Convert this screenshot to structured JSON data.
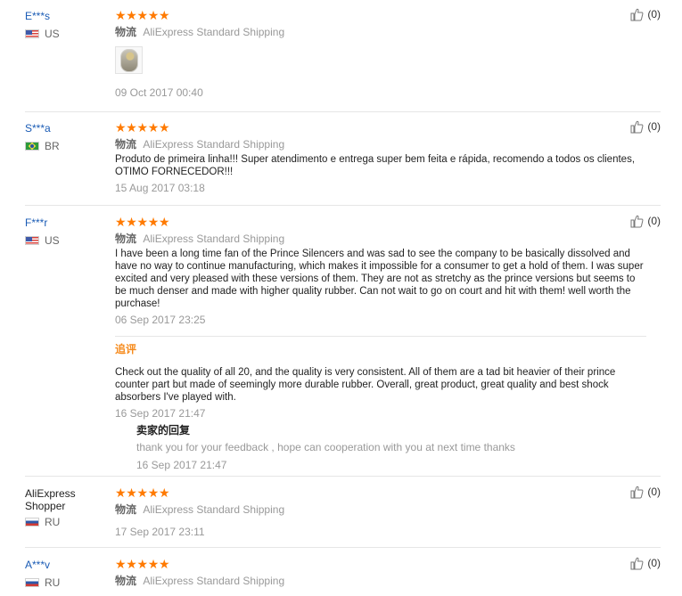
{
  "shipping_label": "物流",
  "stars": "★★★★★",
  "reviews": [
    {
      "username": "E***s",
      "country": "US",
      "shipping": "AliExpress Standard Shipping",
      "text": "",
      "date": "09 Oct 2017 00:40",
      "helpful": "(0)"
    },
    {
      "username": "S***a",
      "country": "BR",
      "shipping": "AliExpress Standard Shipping",
      "text": "Produto de primeira linha!!! Super atendimento e entrega super bem feita e rápida, recomendo a todos os clientes, OTIMO FORNECEDOR!!!",
      "date": "15 Aug 2017 03:18",
      "helpful": "(0)"
    },
    {
      "username": "F***r",
      "country": "US",
      "shipping": "AliExpress Standard Shipping",
      "text": "I have been a long time fan of the Prince Silencers and was sad to see the company to be basically dissolved and have no way to continue manufacturing, which makes it impossible for a consumer to get a hold of them. I was super excited and very pleased with these versions of them. They are not as stretchy as the prince versions but seems to be much denser and made with higher quality rubber. Can not wait to go on court and hit with them! well worth the purchase!",
      "date": "06 Sep 2017 23:25",
      "helpful": "(0)",
      "followup_title": "追评",
      "followup_text": "Check out the quality of all 20, and the quality is very consistent. All of them are a tad bit heavier of their prince counter part but made of seemingly more durable rubber. Overall, great product, great quality and best shock absorbers I've played with.",
      "followup_date": "16 Sep 2017 21:47",
      "seller_reply_title": "卖家的回复",
      "seller_reply_text": "thank you for your feedback , hope can cooperation with you at next time thanks",
      "seller_reply_date": "16 Sep 2017 21:47"
    },
    {
      "username": "AliExpress Shopper",
      "country": "RU",
      "shipping": "AliExpress Standard Shipping",
      "text": "",
      "date": "17 Sep 2017 23:11",
      "helpful": "(0)"
    },
    {
      "username": "A***v",
      "country": "RU",
      "shipping": "AliExpress Standard Shipping",
      "text": "",
      "date": "",
      "helpful": "(0)"
    }
  ]
}
